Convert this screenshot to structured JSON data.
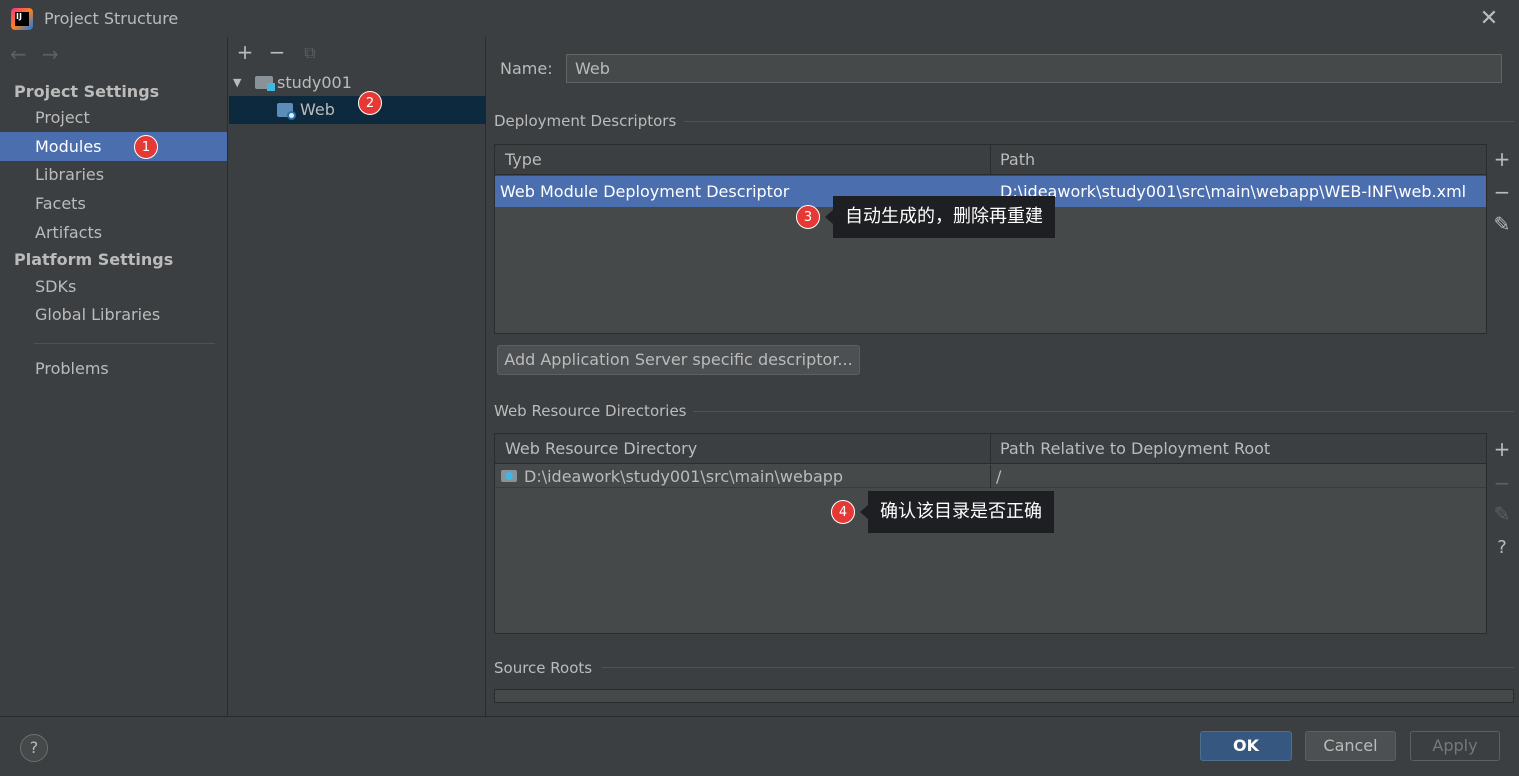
{
  "window": {
    "title": "Project Structure",
    "close_glyph": "✕"
  },
  "nav": {
    "back": "←",
    "forward": "→",
    "project_settings_header": "Project Settings",
    "platform_settings_header": "Platform Settings",
    "project_items": [
      {
        "label": "Project"
      },
      {
        "label": "Modules",
        "selected": true
      },
      {
        "label": "Libraries"
      },
      {
        "label": "Facets"
      },
      {
        "label": "Artifacts"
      }
    ],
    "platform_items": [
      {
        "label": "SDKs"
      },
      {
        "label": "Global Libraries"
      }
    ],
    "problems": "Problems"
  },
  "tree": {
    "toolbar": {
      "add": "+",
      "remove": "−",
      "copy": "⧉"
    },
    "root": {
      "label": "study001",
      "toggle": "▼"
    },
    "child": {
      "label": "Web",
      "selected": true
    }
  },
  "badges": [
    "1",
    "2",
    "3",
    "4"
  ],
  "module": {
    "name_label": "Name:",
    "name_value": "Web",
    "deployment": {
      "group_title": "Deployment Descriptors",
      "columns": [
        "Type",
        "Path"
      ],
      "rows": [
        {
          "type": "Web Module Deployment Descriptor",
          "path": "D:\\ideawork\\study001\\src\\main\\webapp\\WEB-INF\\web.xml",
          "selected": true
        }
      ],
      "tools": {
        "add": "+",
        "remove": "−",
        "edit": "✎"
      },
      "add_server_button": "Add Application Server specific descriptor..."
    },
    "web_resources": {
      "group_title": "Web Resource Directories",
      "columns": [
        "Web Resource Directory",
        "Path Relative to Deployment Root"
      ],
      "rows": [
        {
          "directory": "D:\\ideawork\\study001\\src\\main\\webapp",
          "relative": "/"
        }
      ],
      "tools": {
        "add": "+",
        "remove": "−",
        "edit": "✎",
        "help": "?"
      }
    },
    "source_roots": {
      "group_title": "Source Roots"
    }
  },
  "annotations": {
    "tooltip_3": "自动生成的，删除再重建",
    "tooltip_4": "确认该目录是否正确"
  },
  "footer": {
    "help": "?",
    "ok": "OK",
    "cancel": "Cancel",
    "apply": "Apply"
  },
  "colors": {
    "selection": "#4b6eaf",
    "tree_selection": "#0d293e",
    "badge": "#e53935",
    "background": "#3c3f41"
  }
}
